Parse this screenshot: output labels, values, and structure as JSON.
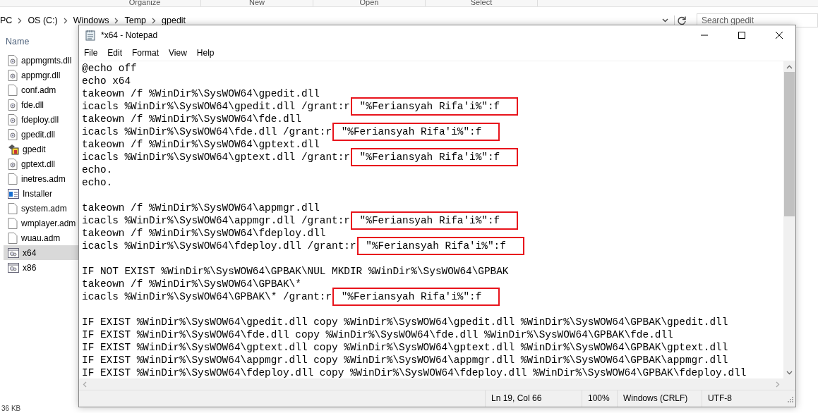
{
  "explorer": {
    "ribbon_groups": [
      "Organize",
      "New",
      "Open",
      "Select"
    ],
    "breadcrumbs": [
      "PC",
      "OS (C:)",
      "Windows",
      "Temp",
      "gpedit"
    ],
    "search": {
      "placeholder": "Search gpedit"
    },
    "column_header": "Name",
    "files": [
      {
        "name": "appmgmts.dll",
        "kind": "dll",
        "selected": false
      },
      {
        "name": "appmgr.dll",
        "kind": "dll",
        "selected": false
      },
      {
        "name": "conf.adm",
        "kind": "file",
        "selected": false
      },
      {
        "name": "fde.dll",
        "kind": "dll",
        "selected": false
      },
      {
        "name": "fdeploy.dll",
        "kind": "dll",
        "selected": false
      },
      {
        "name": "gpedit.dll",
        "kind": "dll",
        "selected": false
      },
      {
        "name": "gpedit",
        "kind": "app",
        "selected": false
      },
      {
        "name": "gptext.dll",
        "kind": "dll",
        "selected": false
      },
      {
        "name": "inetres.adm",
        "kind": "file",
        "selected": false
      },
      {
        "name": "Installer",
        "kind": "installer",
        "selected": false
      },
      {
        "name": "system.adm",
        "kind": "file",
        "selected": false
      },
      {
        "name": "wmplayer.adm",
        "kind": "file",
        "selected": false
      },
      {
        "name": "wuau.adm",
        "kind": "file",
        "selected": false
      },
      {
        "name": "x64",
        "kind": "script",
        "selected": true
      },
      {
        "name": "x86",
        "kind": "script",
        "selected": false
      }
    ],
    "status": "36 KB"
  },
  "notepad": {
    "title": "*x64 - Notepad",
    "menu": [
      "File",
      "Edit",
      "Format",
      "View",
      "Help"
    ],
    "lines": [
      {
        "kind": "code",
        "text": "@echo off"
      },
      {
        "kind": "code",
        "text": "echo x64"
      },
      {
        "kind": "code",
        "text": "takeown /f %WinDir%\\SysWOW64\\gpedit.dll"
      },
      {
        "kind": "code",
        "text": "icacls %WinDir%\\SysWOW64\\gpedit.dll /grant:r",
        "marked": " \"%Feriansyah Rifa'i%\":f"
      },
      {
        "kind": "code",
        "text": "takeown /f %WinDir%\\SysWOW64\\fde.dll"
      },
      {
        "kind": "code",
        "text": "icacls %WinDir%\\SysWOW64\\fde.dll /grant:r",
        "marked": " \"%Feriansyah Rifa'i%\":f"
      },
      {
        "kind": "code",
        "text": "takeown /f %WinDir%\\SysWOW64\\gptext.dll"
      },
      {
        "kind": "code",
        "text": "icacls %WinDir%\\SysWOW64\\gptext.dll /grant:r",
        "marked": " \"%Feriansyah Rifa'i%\":f"
      },
      {
        "kind": "code",
        "text": "echo."
      },
      {
        "kind": "code",
        "text": "echo."
      },
      {
        "kind": "blank"
      },
      {
        "kind": "code",
        "text": "takeown /f %WinDir%\\SysWOW64\\appmgr.dll"
      },
      {
        "kind": "code",
        "text": "icacls %WinDir%\\SysWOW64\\appmgr.dll /grant:r",
        "marked": " \"%Feriansyah Rifa'i%\":f"
      },
      {
        "kind": "code",
        "text": "takeown /f %WinDir%\\SysWOW64\\fdeploy.dll"
      },
      {
        "kind": "code",
        "text": "icacls %WinDir%\\SysWOW64\\fdeploy.dll /grant:r",
        "marked": " \"%Feriansyah Rifa'i%\":f"
      },
      {
        "kind": "blank"
      },
      {
        "kind": "code",
        "text": "IF NOT EXIST %WinDir%\\SysWOW64\\GPBAK\\NUL MKDIR %WinDir%\\SysWOW64\\GPBAK"
      },
      {
        "kind": "code",
        "text": "takeown /f %WinDir%\\SysWOW64\\GPBAK\\*"
      },
      {
        "kind": "code",
        "text": "icacls %WinDir%\\SysWOW64\\GPBAK\\* /grant:r",
        "marked": " \"%Feriansyah Rifa'i%\":f"
      },
      {
        "kind": "blank"
      },
      {
        "kind": "code",
        "text": "IF EXIST %WinDir%\\SysWOW64\\gpedit.dll copy %WinDir%\\SysWOW64\\gpedit.dll %WinDir%\\SysWOW64\\GPBAK\\gpedit.dll"
      },
      {
        "kind": "code",
        "text": "IF EXIST %WinDir%\\SysWOW64\\fde.dll copy %WinDir%\\SysWOW64\\fde.dll %WinDir%\\SysWOW64\\GPBAK\\fde.dll"
      },
      {
        "kind": "code",
        "text": "IF EXIST %WinDir%\\SysWOW64\\gptext.dll copy %WinDir%\\SysWOW64\\gptext.dll %WinDir%\\SysWOW64\\GPBAK\\gptext.dll"
      },
      {
        "kind": "code",
        "text": "IF EXIST %WinDir%\\SysWOW64\\appmgr.dll copy %WinDir%\\SysWOW64\\appmgr.dll %WinDir%\\SysWOW64\\GPBAK\\appmgr.dll"
      },
      {
        "kind": "code",
        "text": "IF EXIST %WinDir%\\SysWOW64\\fdeploy.dll copy %WinDir%\\SysWOW64\\fdeploy.dll %WinDir%\\SysWOW64\\GPBAK\\fdeploy.dll"
      }
    ],
    "status_bar": {
      "position": "Ln 19, Col 66",
      "zoom": "100%",
      "line_endings": "Windows (CRLF)",
      "encoding": "UTF-8"
    }
  }
}
